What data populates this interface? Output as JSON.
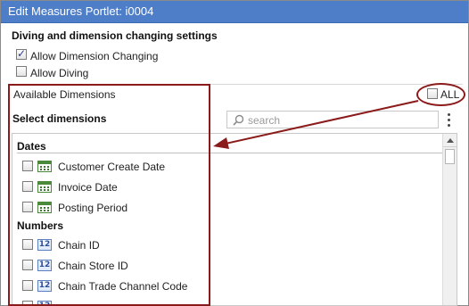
{
  "dialog": {
    "title": "Edit Measures Portlet: i0004"
  },
  "settings": {
    "section_title": "Diving and dimension changing settings",
    "allow_dimension_changing": {
      "label": "Allow Dimension Changing",
      "checked": true
    },
    "allow_diving": {
      "label": "Allow Diving",
      "checked": false
    }
  },
  "dimensions": {
    "available_label": "Available Dimensions",
    "all_label": "ALL",
    "select_title": "Select dimensions",
    "search_placeholder": "search",
    "groups": [
      {
        "name": "Dates",
        "icon": "calendar-icon",
        "items": [
          "Customer Create Date",
          "Invoice Date",
          "Posting Period"
        ]
      },
      {
        "name": "Numbers",
        "icon": "number-icon",
        "icon_text": "12",
        "items": [
          "Chain ID",
          "Chain Store ID",
          "Chain Trade Channel Code"
        ]
      }
    ]
  },
  "annotation": {
    "color": "#8b1a1a"
  },
  "colors": {
    "titlebar": "#4f7ec8",
    "accent_dark_red": "#8b1a1a"
  }
}
